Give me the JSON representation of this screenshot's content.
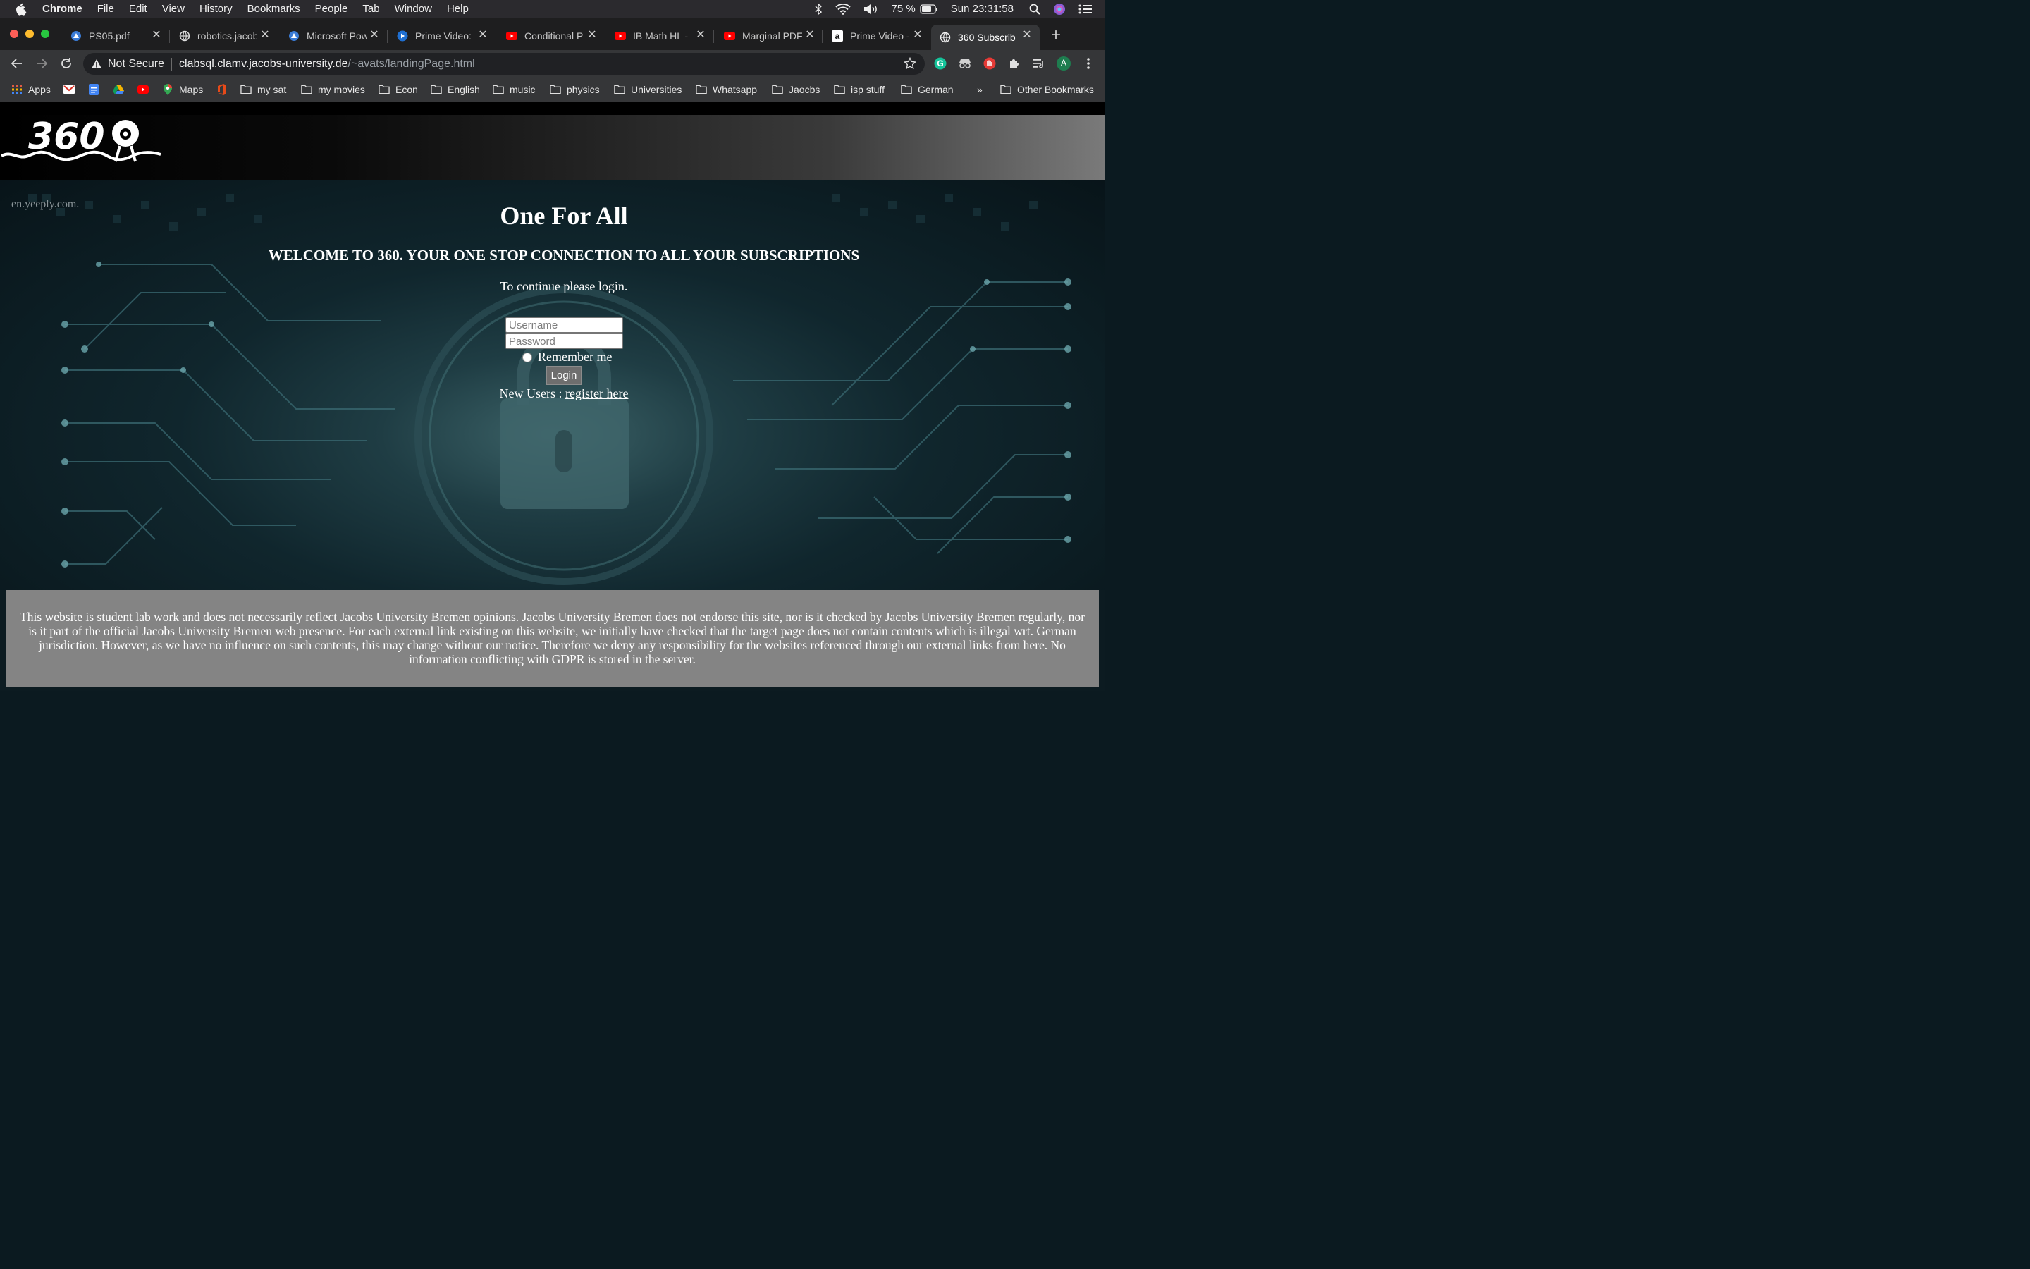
{
  "menubar": {
    "app": "Chrome",
    "items": [
      "File",
      "Edit",
      "View",
      "History",
      "Bookmarks",
      "People",
      "Tab",
      "Window",
      "Help"
    ],
    "battery": "75 %",
    "clock": "Sun 23:31:58"
  },
  "tabs": [
    {
      "title": "PS05.pdf",
      "icon": "drive-icon"
    },
    {
      "title": "robotics.jacob",
      "icon": "globe-icon"
    },
    {
      "title": "Microsoft Pow",
      "icon": "drive-icon"
    },
    {
      "title": "Prime Video: I",
      "icon": "prime-video-icon"
    },
    {
      "title": "Conditional P",
      "icon": "youtube-icon"
    },
    {
      "title": "IB Math HL - ",
      "icon": "youtube-icon"
    },
    {
      "title": "Marginal PDF",
      "icon": "youtube-icon"
    },
    {
      "title": "Prime Video - ",
      "icon": "amazon-icon"
    },
    {
      "title": "360 Subscrib",
      "icon": "globe-icon",
      "active": true
    }
  ],
  "omnibox": {
    "security": "Not Secure",
    "host": "clabsql.clamv.jacobs-university.de",
    "path": "/~avats/landingPage.html"
  },
  "bookmarks": [
    {
      "label": "Apps",
      "icon": "apps-grid-icon"
    },
    {
      "label": "",
      "icon": "gmail-icon"
    },
    {
      "label": "",
      "icon": "docs-icon"
    },
    {
      "label": "",
      "icon": "drive-icon"
    },
    {
      "label": "",
      "icon": "youtube-icon"
    },
    {
      "label": "Maps",
      "icon": "maps-icon"
    },
    {
      "label": "",
      "icon": "office-icon"
    },
    {
      "label": "my sat",
      "icon": "folder-icon"
    },
    {
      "label": "my movies",
      "icon": "folder-icon"
    },
    {
      "label": "Econ",
      "icon": "folder-icon"
    },
    {
      "label": "English",
      "icon": "folder-icon"
    },
    {
      "label": "music",
      "icon": "folder-icon"
    },
    {
      "label": "physics",
      "icon": "folder-icon"
    },
    {
      "label": "Universities",
      "icon": "folder-icon"
    },
    {
      "label": "Whatsapp",
      "icon": "folder-icon"
    },
    {
      "label": "Jaocbs",
      "icon": "folder-icon"
    },
    {
      "label": "isp stuff",
      "icon": "folder-icon"
    },
    {
      "label": "German",
      "icon": "folder-icon"
    }
  ],
  "bookmarks_overflow": "»",
  "other_bookmarks": "Other Bookmarks",
  "profile_initial": "A",
  "page": {
    "logo_text": "360",
    "watermark": "en.yeeply.com.",
    "heading": "One For All",
    "welcome": "WELCOME TO 360. YOUR ONE STOP CONNECTION TO ALL YOUR SUBSCRIPTIONS",
    "instruction": "To continue please login.",
    "username_placeholder": "Username",
    "password_placeholder": "Password",
    "remember_label": "Remember me",
    "login_label": "Login",
    "new_users_prefix": "New Users : ",
    "register_link": "register here",
    "footer": "This website is student lab work and does not necessarily reflect Jacobs University Bremen opinions. Jacobs University Bremen does not endorse this site, nor is it checked by Jacobs University Bremen regularly, nor is it part of the official Jacobs University Bremen web presence. For each external link existing on this website, we initially have checked that the target page does not contain contents which is illegal wrt. German jurisdiction. However, as we have no influence on such contents, this may change without our notice. Therefore we deny any responsibility for the websites referenced through our external links from here. No information conflicting with GDPR is stored in the server."
  }
}
